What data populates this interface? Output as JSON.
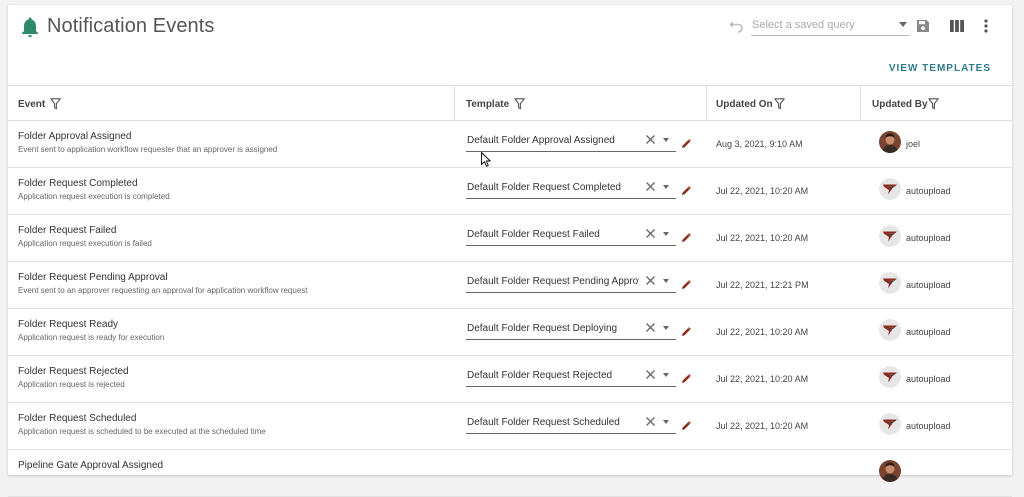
{
  "header": {
    "title": "Notification Events",
    "query_placeholder": "Select a saved query",
    "icons": [
      "bell-icon",
      "undo-icon",
      "save-icon",
      "columns-icon",
      "more-vert-icon"
    ]
  },
  "view_templates_label": "VIEW TEMPLATES",
  "columns": {
    "event": "Event",
    "template": "Template",
    "updated_on": "Updated On",
    "updated_by": "Updated By"
  },
  "rows": [
    {
      "name": "Folder Approval Assigned",
      "desc": "Event sent to application workflow requester that an approver is assigned",
      "template": "Default Folder Approval Assigned",
      "updated_on": "Aug 3, 2021, 9:10 AM",
      "updated_by": "joel",
      "avatar": "photo"
    },
    {
      "name": "Folder Request Completed",
      "desc": "Application request execution is completed",
      "template": "Default Folder Request Completed",
      "updated_on": "Jul 22, 2021, 10:20 AM",
      "updated_by": "autoupload",
      "avatar": "logo"
    },
    {
      "name": "Folder Request Failed",
      "desc": "Application request execution is failed",
      "template": "Default Folder Request Failed",
      "updated_on": "Jul 22, 2021, 10:20 AM",
      "updated_by": "autoupload",
      "avatar": "logo"
    },
    {
      "name": "Folder Request Pending Approval",
      "desc": "Event sent to an approver requesting an approval for application workflow request",
      "template": "Default Folder Request Pending Approval",
      "updated_on": "Jul 22, 2021, 12:21 PM",
      "updated_by": "autoupload",
      "avatar": "logo"
    },
    {
      "name": "Folder Request Ready",
      "desc": "Application request is ready for execution",
      "template": "Default Folder Request Deploying",
      "updated_on": "Jul 22, 2021, 10:20 AM",
      "updated_by": "autoupload",
      "avatar": "logo"
    },
    {
      "name": "Folder Request Rejected",
      "desc": "Application request is rejected",
      "template": "Default Folder Request Rejected",
      "updated_on": "Jul 22, 2021, 10:20 AM",
      "updated_by": "autoupload",
      "avatar": "logo"
    },
    {
      "name": "Folder Request Scheduled",
      "desc": "Application request is scheduled to be executed at the scheduled time",
      "template": "Default Folder Request Scheduled",
      "updated_on": "Jul 22, 2021, 10:20 AM",
      "updated_by": "autoupload",
      "avatar": "logo"
    },
    {
      "name": "Pipeline Gate Approval Assigned",
      "desc": "",
      "template": "",
      "updated_on": "",
      "updated_by": "",
      "avatar": "photo"
    }
  ],
  "colors": {
    "accent": "#2f7a8c",
    "bell": "#2e8b6a",
    "edit": "#8b2a1e"
  }
}
